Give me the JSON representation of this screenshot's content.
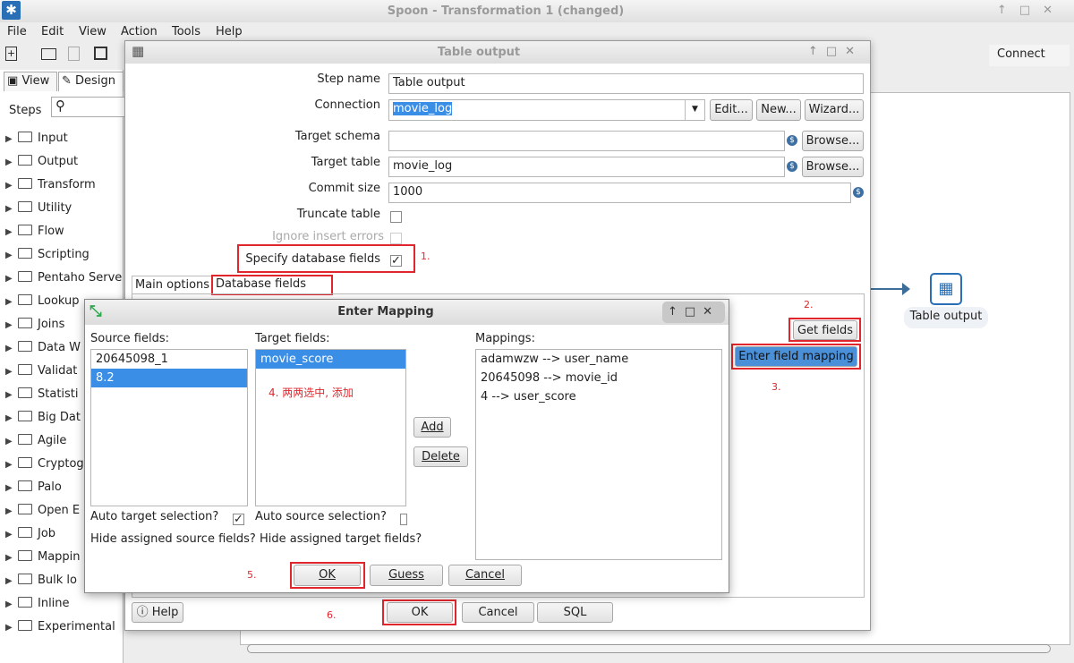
{
  "window": {
    "title": "Spoon - Transformation 1 (changed)"
  },
  "menu": [
    "File",
    "Edit",
    "View",
    "Action",
    "Tools",
    "Help"
  ],
  "left": {
    "tab_view": "View",
    "tab_design": "Design",
    "steps_label": "Steps",
    "items": [
      "Input",
      "Output",
      "Transform",
      "Utility",
      "Flow",
      "Scripting",
      "Pentaho Serve",
      "Lookup",
      "Joins",
      "Data W",
      "Validat",
      "Statisti",
      "Big Dat",
      "Agile",
      "Cryptog",
      "Palo",
      "Open E",
      "Job",
      "Mappin",
      "Bulk lo",
      "Inline",
      "Experimental"
    ]
  },
  "canvas": {
    "connect_tab": "Connect",
    "node_label": "Table output"
  },
  "table_output": {
    "title": "Table output",
    "step_name_label": "Step name",
    "step_name": "Table output",
    "connection_label": "Connection",
    "connection": "movie_log",
    "edit": "Edit...",
    "new": "New...",
    "wizard": "Wizard...",
    "schema_label": "Target schema",
    "schema": "",
    "browse": "Browse...",
    "table_label": "Target table",
    "table": "movie_log",
    "commit_label": "Commit size",
    "commit": "1000",
    "truncate_label": "Truncate table",
    "ignore_label": "Ignore insert errors",
    "specify_label": "Specify database fields",
    "tab_main": "Main options",
    "tab_db": "Database fields",
    "get_fields": "Get fields",
    "enter_mapping": "Enter field mapping",
    "help": "Help",
    "ok": "OK",
    "cancel": "Cancel",
    "sql": "SQL"
  },
  "annotations": {
    "a1": "1.",
    "a2": "2.",
    "a3": "3.",
    "a4": "4. 两两选中, 添加",
    "a5": "5.",
    "a6": "6."
  },
  "mapping": {
    "title": "Enter Mapping",
    "source_label": "Source fields:",
    "source": [
      "20645098_1",
      "8.2"
    ],
    "source_selected": 1,
    "target_label": "Target fields:",
    "target": [
      "movie_score"
    ],
    "target_selected": 0,
    "mappings_label": "Mappings:",
    "mappings": [
      "adamwzw --> user_name",
      "20645098 --> movie_id",
      "4 --> user_score"
    ],
    "add": "Add",
    "delete": "Delete",
    "auto_target": "Auto target selection?",
    "auto_source": "Auto source selection?",
    "hide_source": "Hide assigned source fields?",
    "hide_target": "Hide assigned target fields?",
    "ok": "OK",
    "guess": "Guess",
    "cancel": "Cancel"
  },
  "colors": {
    "accent": "#3a8ee6",
    "annotation": "#e0262c"
  }
}
